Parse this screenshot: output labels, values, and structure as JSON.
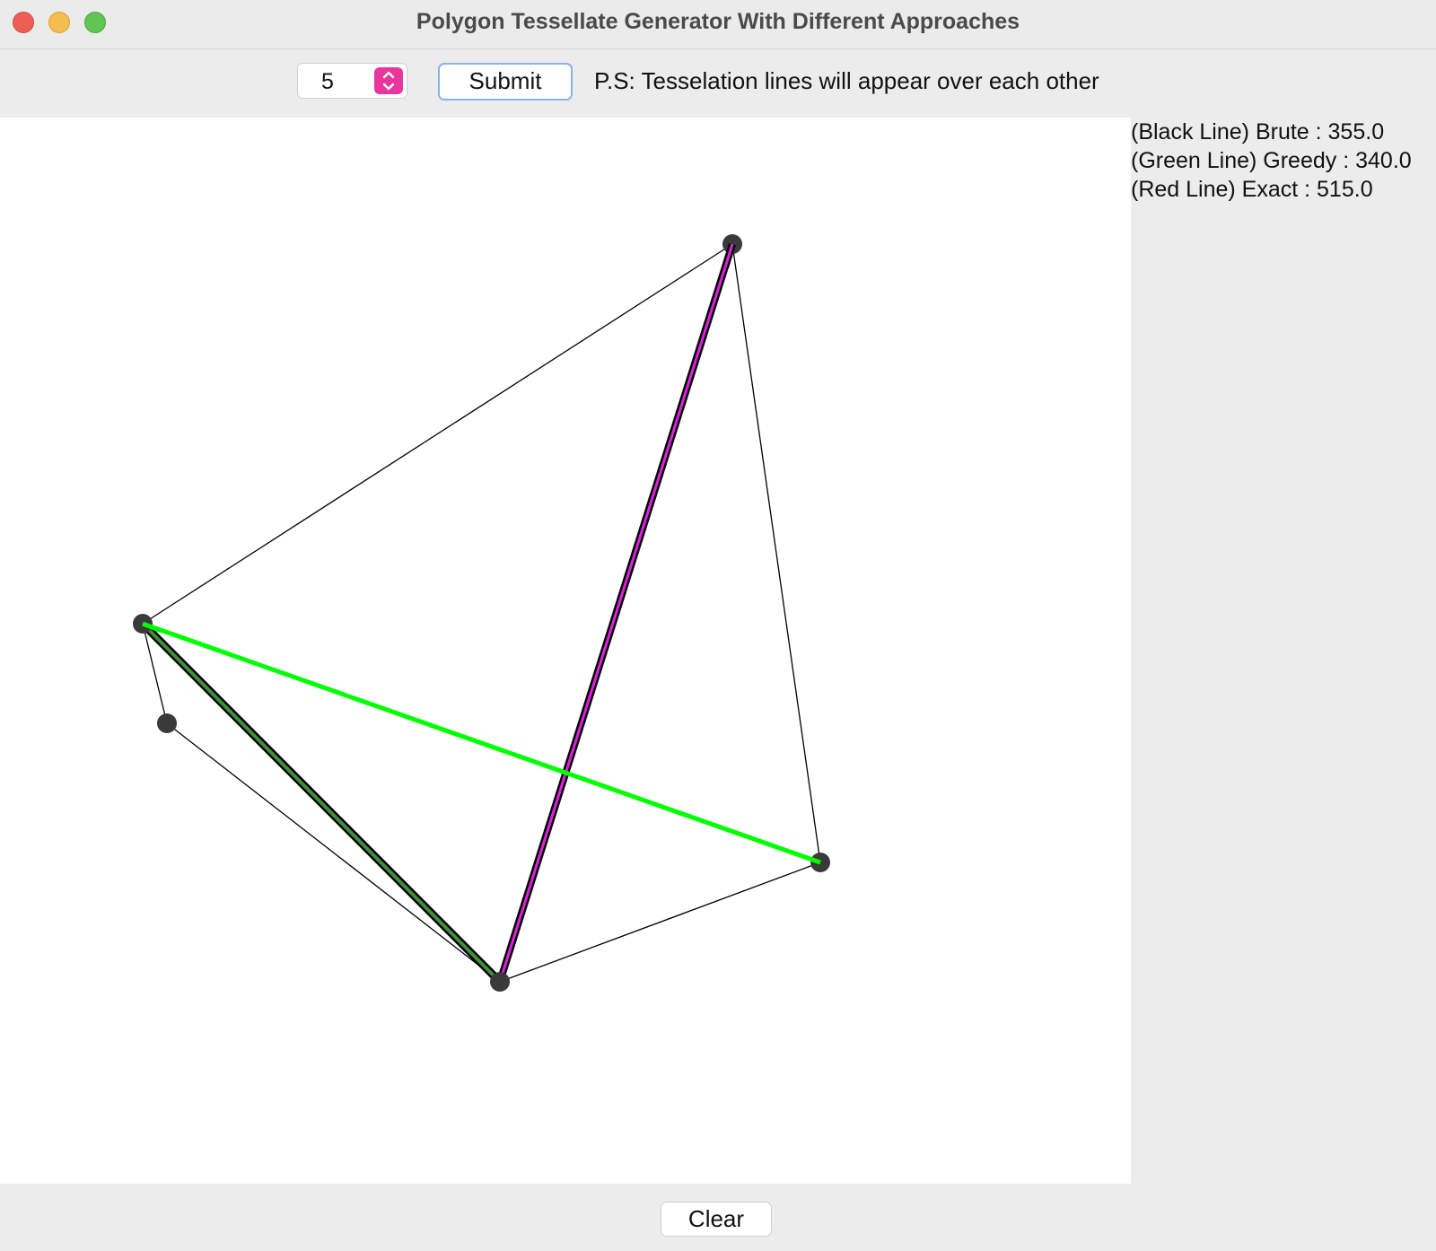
{
  "window": {
    "title": "Polygon Tessellate Generator With Different Approaches"
  },
  "toolbar": {
    "vertex_count": "5",
    "submit_label": "Submit",
    "note": "P.S: Tesselation lines will appear over each other"
  },
  "results": {
    "brute": "(Black Line) Brute : 355.0",
    "greedy": "(Green Line) Greedy : 340.0",
    "exact": "(Red Line) Exact : 515.0"
  },
  "footer": {
    "clear_label": "Clear"
  },
  "icons": {
    "close": "close-icon",
    "minimize": "minimize-icon",
    "maximize": "maximize-icon",
    "spinner": "up-down-arrows-icon"
  },
  "colors": {
    "brute_line": "#000000",
    "greedy_line": "#00ff00",
    "exact_line": "#e020e0",
    "vertex": "#3a3a3a",
    "spinner_accent": "#e9369c"
  }
}
